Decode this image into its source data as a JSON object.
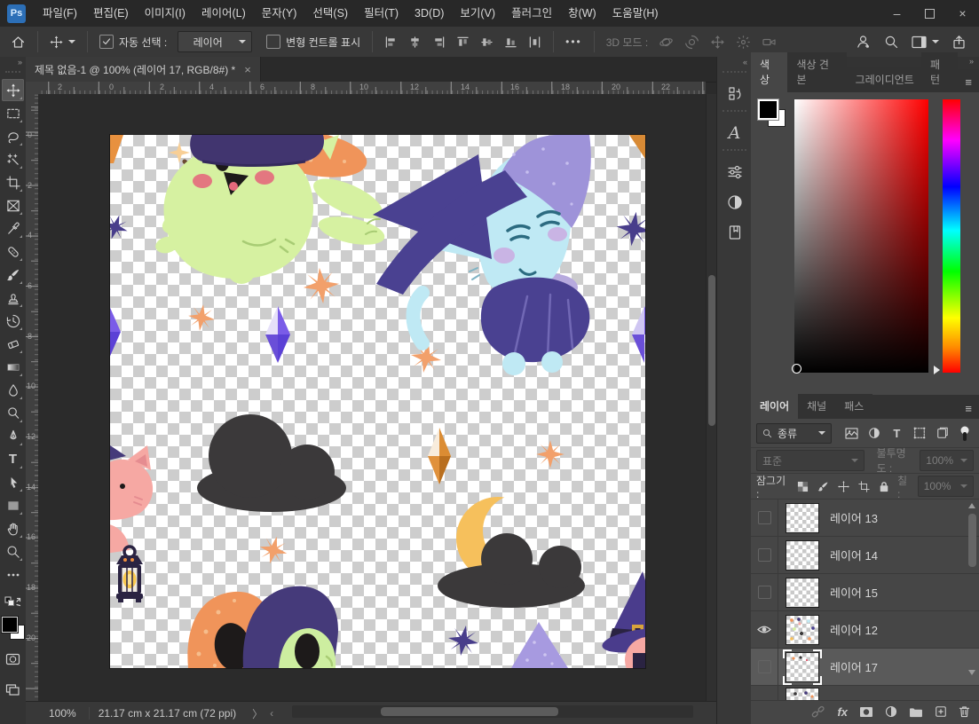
{
  "titlebar": {
    "logo": "Ps",
    "menus": [
      "파일(F)",
      "편집(E)",
      "이미지(I)",
      "레이어(L)",
      "문자(Y)",
      "선택(S)",
      "필터(T)",
      "3D(D)",
      "보기(V)",
      "플러그인",
      "창(W)",
      "도움말(H)"
    ],
    "minimize_glyph": "–",
    "close_glyph": "×"
  },
  "optionsbar": {
    "auto_select_label": "자동 선택 :",
    "auto_select_value": "레이어",
    "transform_label": "변형 컨트롤 표시",
    "mode3d_label": "3D 모드 :",
    "more_glyph": "•••"
  },
  "tabbar": {
    "document_title": "제목 없음-1 @ 100% (레이어 17, RGB/8#) *",
    "close_glyph": "×"
  },
  "rulers": {
    "h": [
      "2",
      "0",
      "2",
      "4",
      "6",
      "8",
      "10",
      "12",
      "14",
      "16",
      "18",
      "20",
      "22"
    ],
    "v": [
      "0",
      "2",
      "4",
      "6",
      "8",
      "10",
      "12",
      "14",
      "16",
      "18",
      "20"
    ]
  },
  "statusbar": {
    "zoom": "100%",
    "dimensions": "21.17 cm x 21.17 cm (72 ppi)",
    "chevron": "〉",
    "left_arrow": "‹"
  },
  "glyphs": {
    "expand_right": "»",
    "expand_left": "«",
    "hamburger": "≡",
    "glyph_panel_letter": "A",
    "fx": "fx",
    "type_tool": "T"
  },
  "toolbar": {
    "tools": [
      "move",
      "rectangular-marquee",
      "lasso",
      "magic-wand",
      "crop",
      "frame",
      "eyedropper",
      "spot-healing",
      "brush",
      "clone-stamp",
      "history-brush",
      "eraser",
      "gradient",
      "blur",
      "dodge",
      "pen",
      "type",
      "path-selection",
      "rectangle",
      "hand",
      "zoom",
      "more"
    ]
  },
  "color_panel": {
    "tabs": [
      "색상",
      "색상 견본",
      "그레이디언트",
      "패턴"
    ],
    "active_tab": "색상",
    "foreground_color": "#000000",
    "background_color": "#ffffff"
  },
  "layers_panel": {
    "tabs": [
      "레이어",
      "채널",
      "패스"
    ],
    "active_tab": "레이어",
    "search_label": "종류",
    "blend_mode": "표준",
    "opacity_label": "불투명도 :",
    "opacity_value": "100%",
    "lock_label": "잠그기 :",
    "fill_label": "칠 :",
    "fill_value": "100%",
    "rows": [
      {
        "name": "레이어 13",
        "visible": false,
        "selected": false
      },
      {
        "name": "레이어 14",
        "visible": false,
        "selected": false
      },
      {
        "name": "레이어 15",
        "visible": false,
        "selected": false
      },
      {
        "name": "레이어 12",
        "visible": true,
        "selected": false
      },
      {
        "name": "레이어 17",
        "visible": false,
        "selected": true
      }
    ]
  },
  "palette": {
    "cat_green": "#d6f1a1",
    "cat_blue": "#bfe9f4",
    "cat_pink": "#f6a8a3",
    "witch_purple": "#4a4191",
    "hood_purple": "#453a7a",
    "sparkle_orange": "#f2a06b",
    "star_purple": "#483d8b",
    "cloud_gray": "#3b393a",
    "moon_yellow": "#f6c05c",
    "gem_purple": "#6a4fd8",
    "gem_orange": "#db8c33",
    "lantern_navy": "#2a2342",
    "lantern_glow": "#f9c84e"
  }
}
